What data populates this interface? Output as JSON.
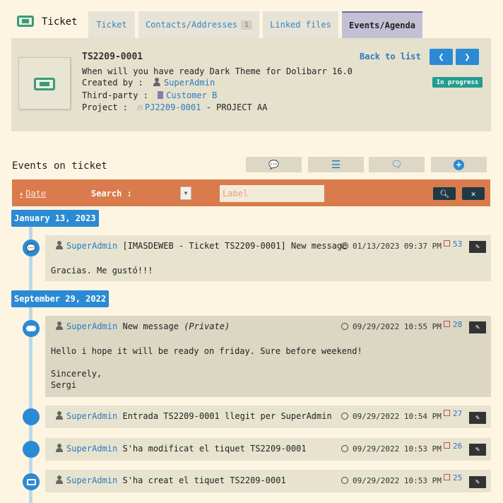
{
  "header": {
    "title": "Ticket",
    "tabs": [
      {
        "label": "Ticket"
      },
      {
        "label": "Contacts/Addresses",
        "badge": "1"
      },
      {
        "label": "Linked files"
      },
      {
        "label": "Events/Agenda"
      }
    ]
  },
  "ticket": {
    "ref": "TS2209-0001",
    "subject": "When will you have ready Dark Theme for Dolibarr 16.0",
    "created_by_label": "Created by :",
    "created_by": "SuperAdmin",
    "third_party_label": "Third-party :",
    "third_party": "Customer B",
    "project_label": "Project :",
    "project_ref": "PJ2209-0001",
    "project_name": "- PROJECT AA",
    "back_label": "Back to list",
    "status": "In progress"
  },
  "events": {
    "title": "Events on ticket",
    "filter": {
      "date_label": "Date",
      "search_label": "Search :",
      "label_placeholder": "Label"
    },
    "groups": [
      {
        "date": "January 13, 2023",
        "items": [
          {
            "user": "SuperAdmin",
            "text": "[IMASDEWEB - Ticket TS2209-0001] New message",
            "time": "01/13/2023 09:37 PM",
            "id": "53",
            "body": "Gracias. Me gustó!!!"
          }
        ]
      },
      {
        "date": "September 29, 2022",
        "items": [
          {
            "user": "SuperAdmin",
            "text": "New message",
            "private": "(Private)",
            "time": "09/29/2022 10:55 PM",
            "id": "28",
            "body": "Hello i hope it will be ready on friday. Sure before weekend!\n\nSincerely,\nSergi"
          },
          {
            "user": "SuperAdmin",
            "text": "Entrada TS2209-0001 llegit per SuperAdmin",
            "time": "09/29/2022 10:54 PM",
            "id": "27"
          },
          {
            "user": "SuperAdmin",
            "text": "S'ha modificat el tiquet TS2209-0001",
            "time": "09/29/2022 10:53 PM",
            "id": "26"
          },
          {
            "user": "SuperAdmin",
            "text": "S'ha creat el tiquet TS2209-0001",
            "time": "09/29/2022 10:53 PM",
            "id": "25"
          }
        ]
      }
    ]
  },
  "colors": {
    "accent": "#2b8ad4",
    "filter_bar": "#d97b4c",
    "status": "#259c8f"
  }
}
